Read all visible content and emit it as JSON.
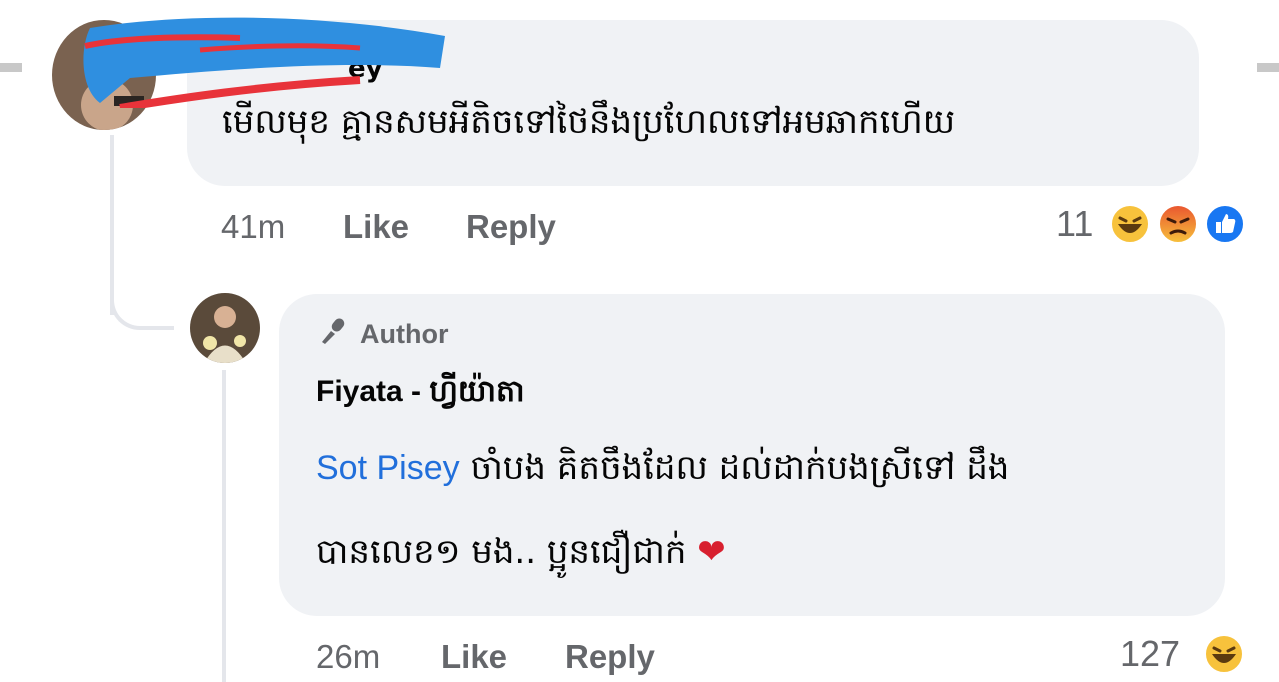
{
  "comment": {
    "author_partial": "ey",
    "text": "មើលមុខ គ្មានសមអីតិចទៅថៃនឹងប្រហែលទៅអមឆាកហើយ",
    "time": "41m",
    "like_label": "Like",
    "reply_label": "Reply",
    "reaction_count": "11",
    "reactions": [
      "laugh-emoji-icon",
      "angry-emoji-icon",
      "like-reaction-icon"
    ]
  },
  "reply": {
    "badge": "Author",
    "author": "Fiyata - ហ្វីយ៉ាតា",
    "mention": "Sot Pisey",
    "text_line1": "ចាំបង គិតចឹងដែល ដល់ដាក់បងស្រីទៅ ដឹង",
    "text_line2": "បានលេខ១ មង.. ប្អូនជឿជាក់",
    "heart": "❤",
    "time": "26m",
    "like_label": "Like",
    "reply_label": "Reply",
    "reaction_count": "127",
    "reactions": [
      "laugh-emoji-icon"
    ]
  },
  "colors": {
    "bubble": "#f0f2f5",
    "mention": "#216fdb",
    "meta_text": "#65676b",
    "like_blue": "#1877f2",
    "heart": "#d8202f"
  }
}
